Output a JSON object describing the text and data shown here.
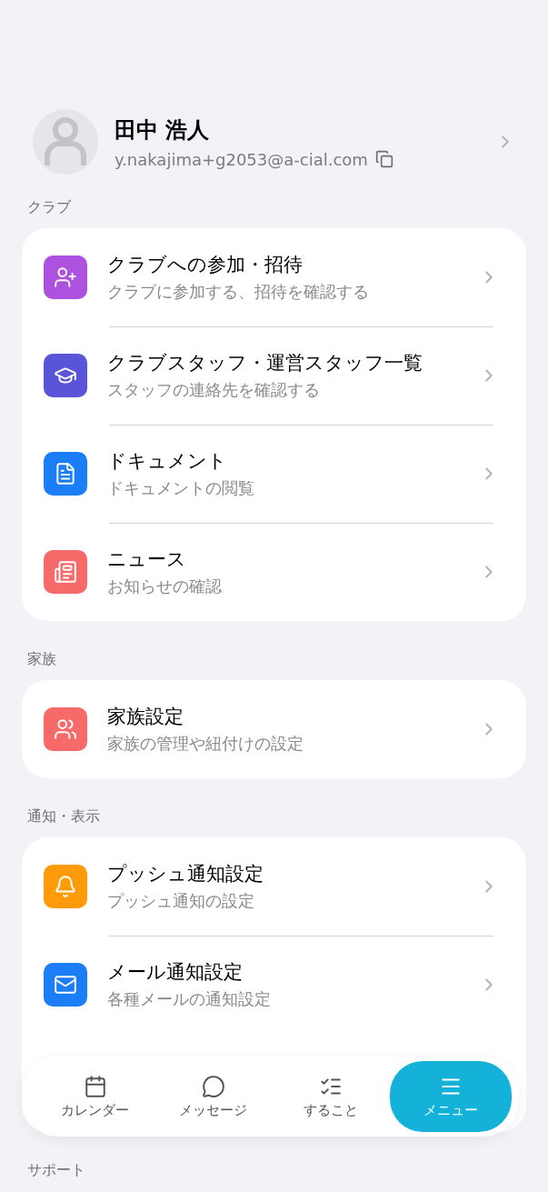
{
  "profile": {
    "name": "田中 浩人",
    "email": "y.nakajima+g2053@a-cial.com"
  },
  "sections": [
    {
      "label": "クラブ",
      "items": [
        {
          "title": "クラブへの参加・招待",
          "subtitle": "クラブに参加する、招待を確認する",
          "color": "#ac52df"
        },
        {
          "title": "クラブスタッフ・運営スタッフ一覧",
          "subtitle": "スタッフの連絡先を確認する",
          "color": "#5a54d8"
        },
        {
          "title": "ドキュメント",
          "subtitle": "ドキュメントの閲覧",
          "color": "#1b7ef6"
        },
        {
          "title": "ニュース",
          "subtitle": "お知らせの確認",
          "color": "#f66a6a"
        }
      ]
    },
    {
      "label": "家族",
      "items": [
        {
          "title": "家族設定",
          "subtitle": "家族の管理や紐付けの設定",
          "color": "#f66a6a"
        }
      ]
    },
    {
      "label": "通知・表示",
      "items": [
        {
          "title": "プッシュ通知設定",
          "subtitle": "プッシュ通知の設定",
          "color": "#ff9a0a"
        },
        {
          "title": "メール通知設定",
          "subtitle": "各種メールの通知設定",
          "color": "#1b7ef6"
        }
      ]
    },
    {
      "label": "サポート"
    }
  ],
  "nav": [
    {
      "label": "カレンダー",
      "selected": false
    },
    {
      "label": "メッセージ",
      "selected": false
    },
    {
      "label": "すること",
      "selected": false
    },
    {
      "label": "メニュー",
      "selected": true
    }
  ]
}
